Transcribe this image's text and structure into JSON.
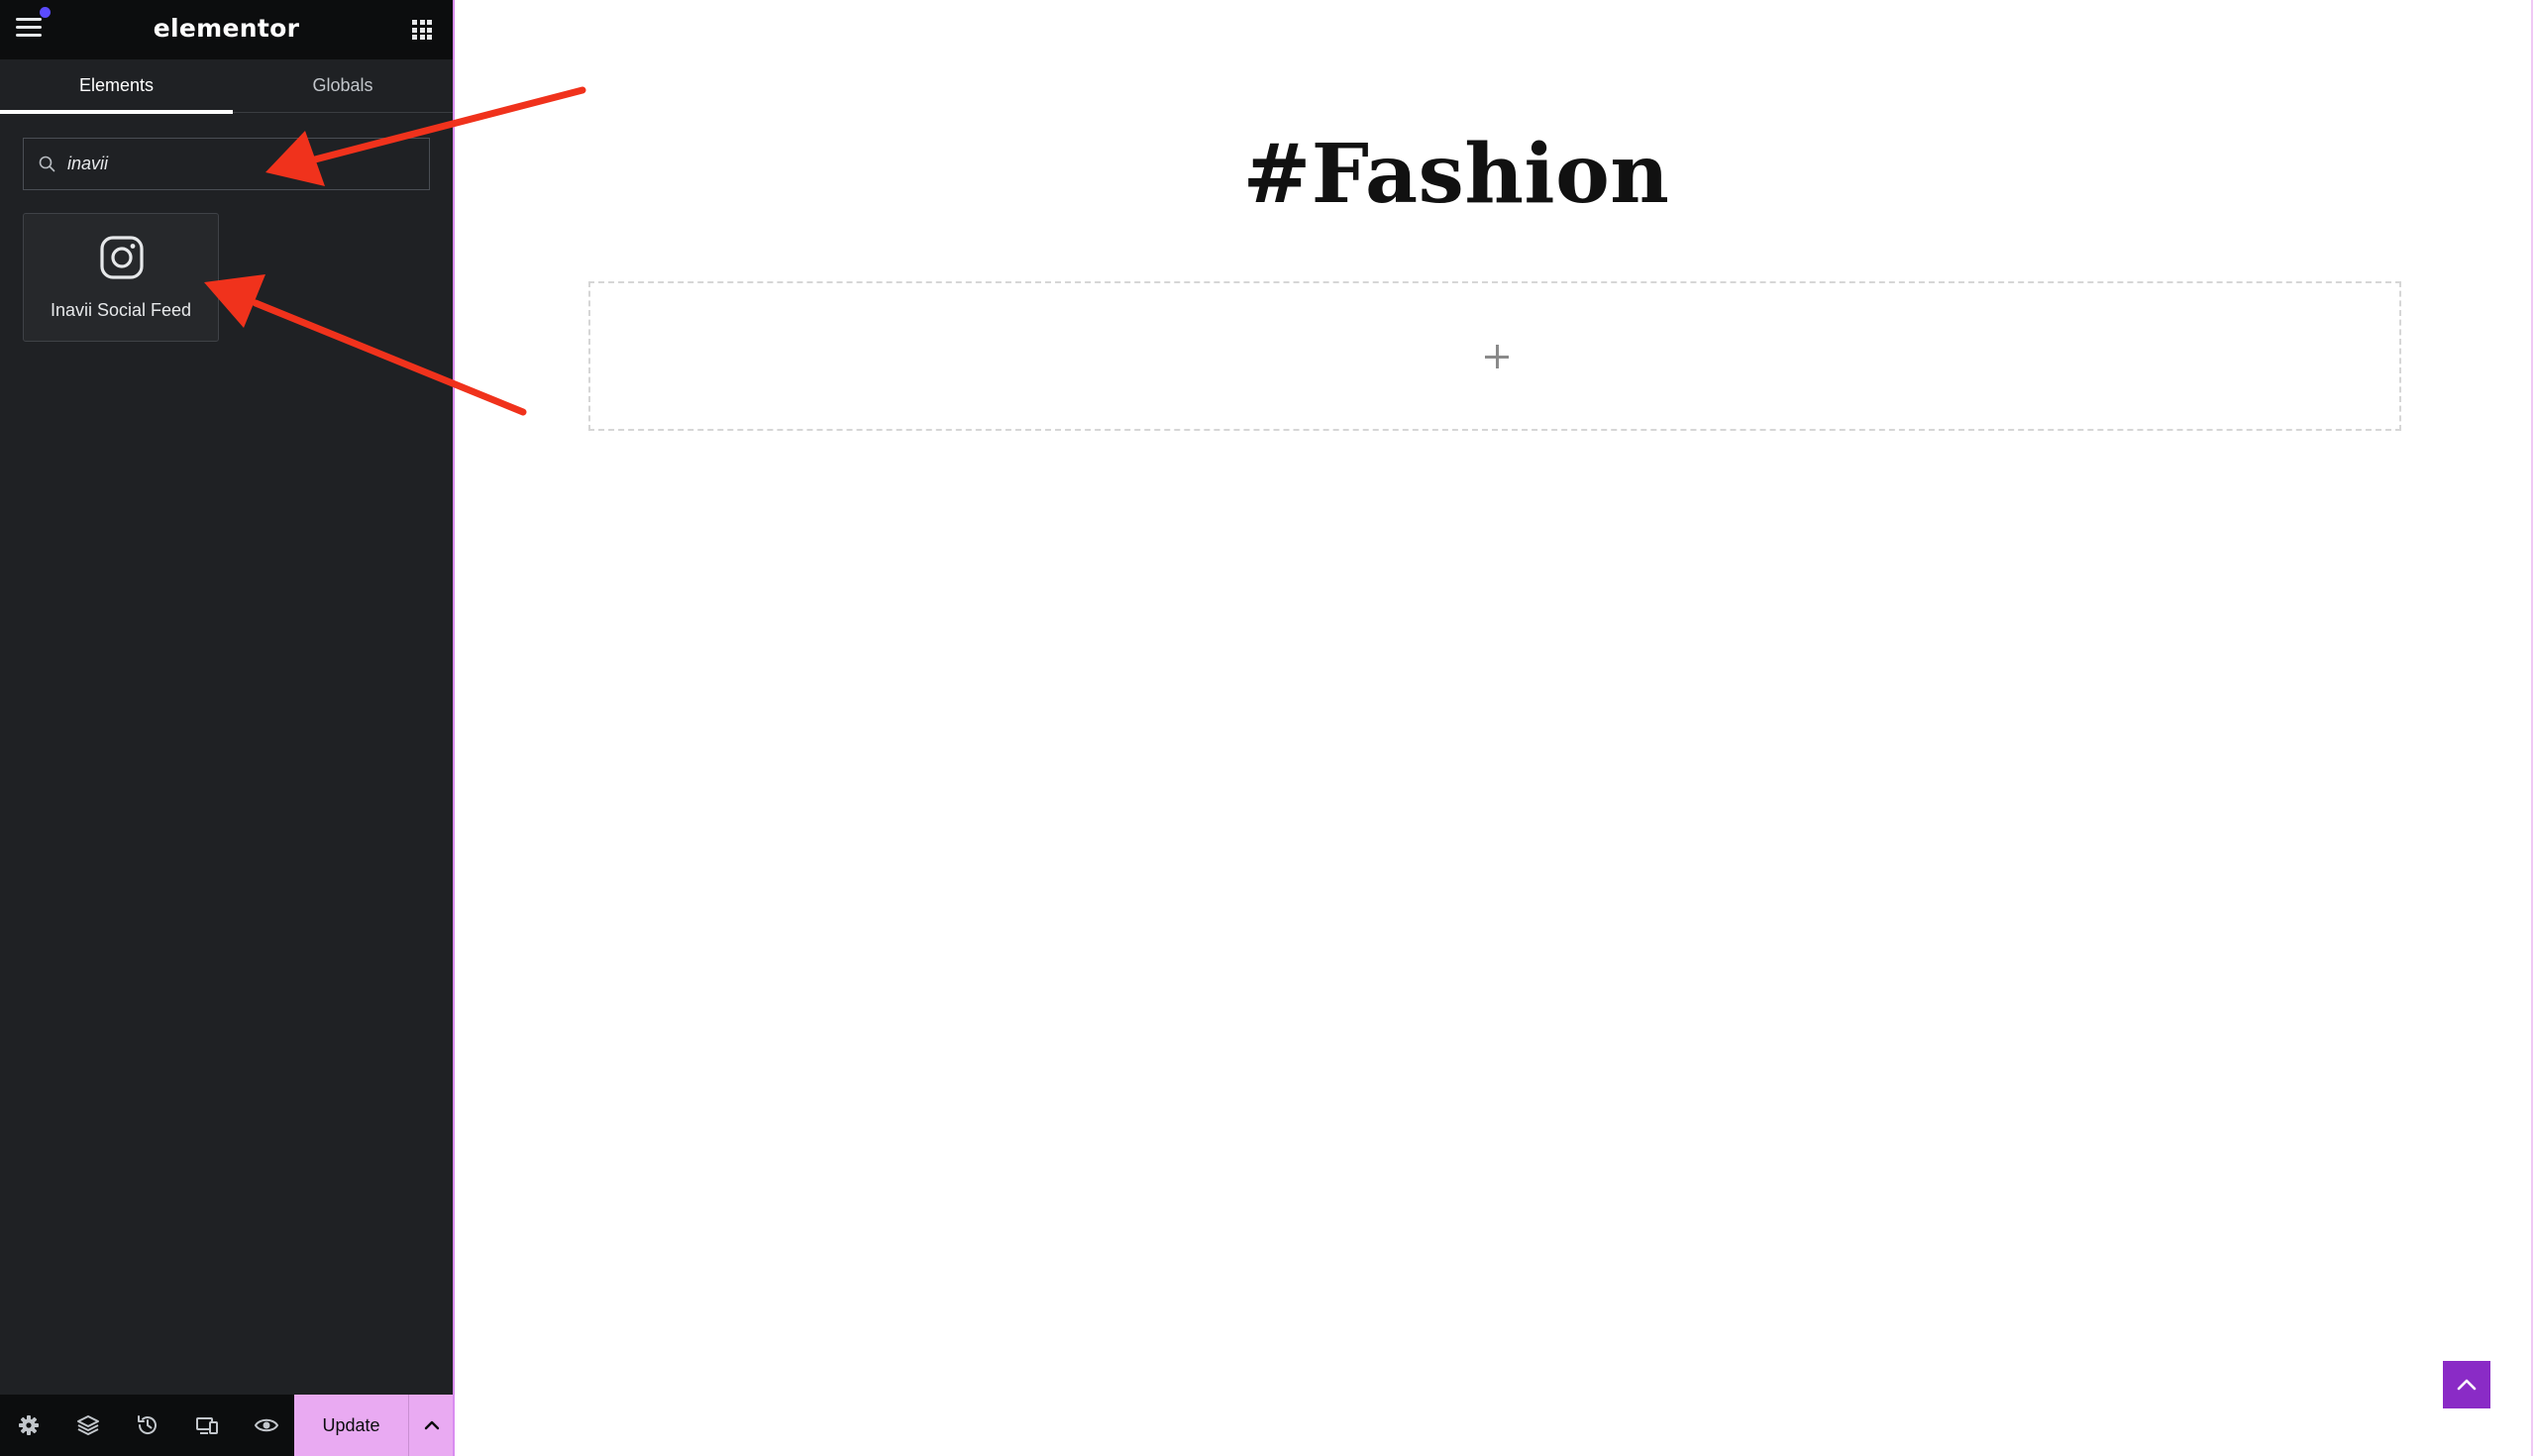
{
  "app": {
    "logo": "elementor"
  },
  "panel": {
    "tabs": [
      {
        "label": "Elements",
        "active": true
      },
      {
        "label": "Globals",
        "active": false
      }
    ],
    "search": {
      "value": "inavii",
      "placeholder": "Search Widget..."
    },
    "widgets": [
      {
        "label": "Inavii Social Feed",
        "icon": "instagram-icon"
      }
    ],
    "footer": {
      "icons": [
        "settings-icon",
        "layers-icon",
        "history-icon",
        "responsive-icon",
        "eye-icon"
      ],
      "update_label": "Update"
    }
  },
  "canvas": {
    "heading": "#Fashion"
  },
  "colors": {
    "panel_bg": "#1f2124",
    "header_bg": "#0c0d0e",
    "accent_update": "#e9aaf2",
    "notification_dot": "#5b4bff",
    "scroll_top": "#8a2bc6",
    "annotation_arrow": "#f0321c"
  }
}
